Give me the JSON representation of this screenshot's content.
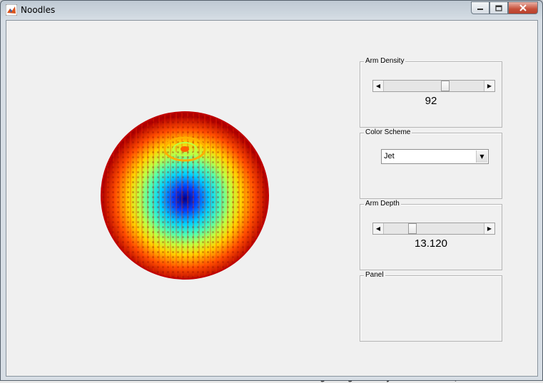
{
  "window": {
    "title": "Noodles",
    "icons": {
      "app": "matlab-icon",
      "minimize": "minimize-icon",
      "maximize": "maximize-icon",
      "close": "close-icon"
    }
  },
  "controls": {
    "arm_density": {
      "label": "Arm Density",
      "value_text": "92",
      "slider_fraction": 0.62
    },
    "color_scheme": {
      "label": "Color Scheme",
      "selected": "Jet"
    },
    "arm_depth": {
      "label": "Arm Depth",
      "value_text": "13.120",
      "slider_fraction": 0.27
    },
    "panel": {
      "label": "Panel"
    }
  },
  "colors": {
    "jet_palette": [
      "#00008f",
      "#0040ff",
      "#00d0ff",
      "#50ffb0",
      "#c0ff40",
      "#ffd000",
      "#ff5000",
      "#b00000"
    ]
  },
  "background_text": "Ine Ultimate Lutorial ultimatum to become learning imagibility tutorials (Ultd"
}
